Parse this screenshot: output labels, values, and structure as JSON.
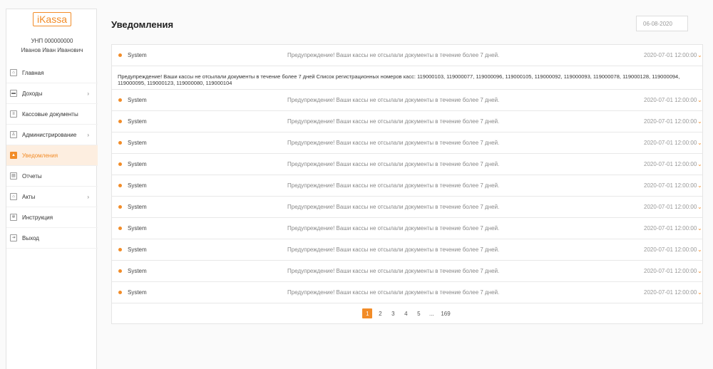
{
  "brand": {
    "logo": "iKassa"
  },
  "user": {
    "unp": "УНП 000000000",
    "name": "Иванов Иван Иванович"
  },
  "menu": [
    {
      "label": "Главная",
      "icon": "home-icon",
      "glyph": "⌂",
      "arrow": ""
    },
    {
      "label": "Доходы",
      "icon": "wallet-icon",
      "glyph": "▬",
      "arrow": "›"
    },
    {
      "label": "Кассовые документы",
      "icon": "document-icon",
      "glyph": "≡",
      "arrow": ""
    },
    {
      "label": "Администрирование",
      "icon": "user-icon",
      "glyph": "♙",
      "arrow": "›"
    },
    {
      "label": "Уведомления",
      "icon": "bell-icon",
      "glyph": "▲",
      "arrow": ""
    },
    {
      "label": "Отчеты",
      "icon": "report-icon",
      "glyph": "▤",
      "arrow": ""
    },
    {
      "label": "Акты",
      "icon": "act-icon",
      "glyph": "⌂",
      "arrow": "›"
    },
    {
      "label": "Инструкция",
      "icon": "gear-icon",
      "glyph": "✲",
      "arrow": ""
    },
    {
      "label": "Выход",
      "icon": "exit-icon",
      "glyph": "⇥",
      "arrow": ""
    }
  ],
  "page": {
    "title": "Уведомления",
    "date": "06-08-2020"
  },
  "notifications": [
    {
      "source": "System",
      "message": "Предупреждение! Ваши кассы не отсылали документы в течение более 7 дней.",
      "date": "2020-07-01 12:00:00"
    },
    {
      "source": "System",
      "message": "Предупреждение! Ваши кассы не отсылали документы в течение более 7 дней.",
      "date": "2020-07-01 12:00:00"
    },
    {
      "source": "System",
      "message": "Предупреждение! Ваши кассы не отсылали документы в течение более 7 дней.",
      "date": "2020-07-01 12:00:00"
    },
    {
      "source": "System",
      "message": "Предупреждение! Ваши кассы не отсылали документы в течение более 7 дней.",
      "date": "2020-07-01 12:00:00"
    },
    {
      "source": "System",
      "message": "Предупреждение! Ваши кассы не отсылали документы в течение более 7 дней.",
      "date": "2020-07-01 12:00:00"
    },
    {
      "source": "System",
      "message": "Предупреждение! Ваши кассы не отсылали документы в течение более 7 дней.",
      "date": "2020-07-01 12:00:00"
    },
    {
      "source": "System",
      "message": "Предупреждение! Ваши кассы не отсылали документы в течение более 7 дней.",
      "date": "2020-07-01 12:00:00"
    },
    {
      "source": "System",
      "message": "Предупреждение! Ваши кассы не отсылали документы в течение более 7 дней.",
      "date": "2020-07-01 12:00:00"
    },
    {
      "source": "System",
      "message": "Предупреждение! Ваши кассы не отсылали документы в течение более 7 дней.",
      "date": "2020-07-01 12:00:00"
    },
    {
      "source": "System",
      "message": "Предупреждение! Ваши кассы не отсылали документы в течение более 7 дней.",
      "date": "2020-07-01 12:00:00"
    },
    {
      "source": "System",
      "message": "Предупреждение! Ваши кассы не отсылали документы в течение более 7 дней.",
      "date": "2020-07-01 12:00:00"
    }
  ],
  "expanded_text": "Предупреждение! Ваши кассы не отсылали документы в течение более 7 дней Список регистрационных номеров касс: 119000103, 119000077, 119000096, 119000105, 119000092, 119000093, 119000078, 119000128, 119000094, 119000095, 119000123, 119000080, 119000104",
  "pagination": [
    "1",
    "2",
    "3",
    "4",
    "5",
    "...",
    "169"
  ],
  "colors": {
    "accent": "#f28c28"
  }
}
